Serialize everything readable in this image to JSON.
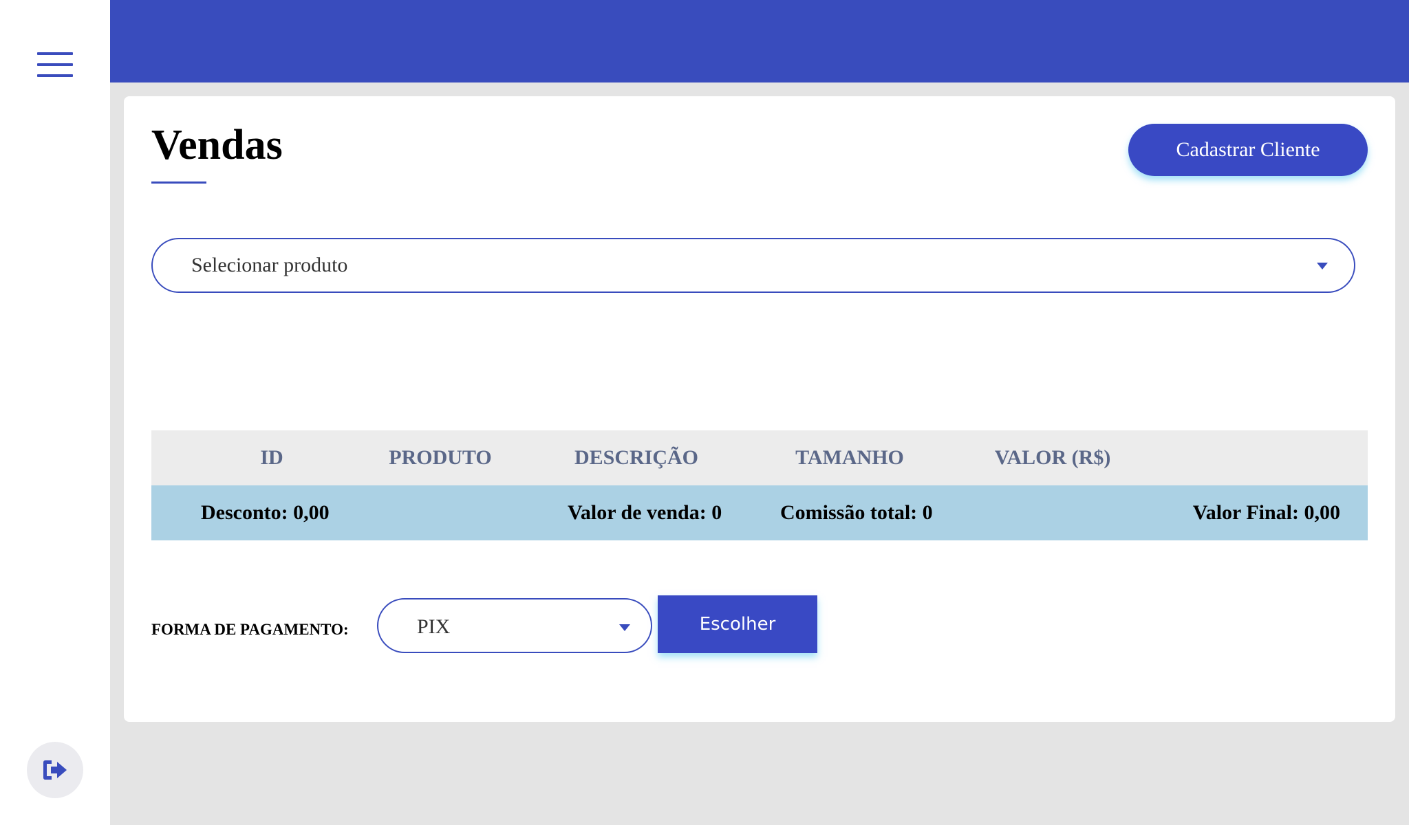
{
  "sidebar": {
    "menu_icon": "hamburger-menu-icon",
    "logout_icon": "sign-out-icon"
  },
  "colors": {
    "primary": "#394cbd",
    "background": "#e4e4e4",
    "table_header": "#ececec",
    "table_footer": "#abd1e4"
  },
  "page": {
    "title": "Vendas",
    "register_button": "Cadastrar Cliente"
  },
  "product_select": {
    "placeholder": "Selecionar produto"
  },
  "table": {
    "columns": [
      "ID",
      "PRODUTO",
      "DESCRIÇÃO",
      "TAMANHO",
      "VALOR (R$)"
    ],
    "summary": {
      "desconto": "Desconto: 0,00",
      "valor_venda": "Valor de venda: 0",
      "comissao_total": "Comissão total: 0",
      "valor_final": "Valor Final: 0,00"
    }
  },
  "payment": {
    "label": "FORMA DE PAGAMENTO:",
    "selected": "PIX",
    "choose_button": "Escolher"
  }
}
